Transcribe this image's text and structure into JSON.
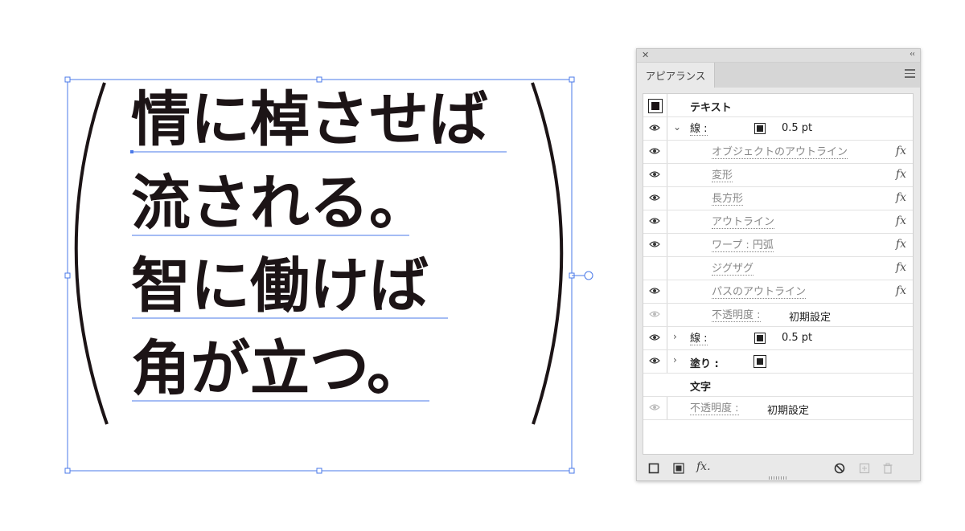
{
  "canvas": {
    "lines": [
      "情に棹させば",
      "流される。",
      "智に働けば",
      "角が立つ。"
    ],
    "text_color": "#1c1416",
    "selection_color": "#4a79e8"
  },
  "panel": {
    "tab_label": "アピアランス",
    "close_icon": "close-icon",
    "collapse_icon": "collapse-icon",
    "menu_icon": "panel-menu-icon",
    "rows": {
      "text_object": "テキスト",
      "stroke1_label": "線 :",
      "stroke1_value": "0.5 pt",
      "effects": [
        "オブジェクトのアウトライン",
        "変形",
        "長方形",
        "アウトライン",
        "ワープ : 円弧",
        "ジグザグ",
        "パスのアウトライン"
      ],
      "fx_label": "fx",
      "opacity_inner_label": "不透明度 :",
      "opacity_inner_value": "初期設定",
      "stroke2_label": "線 :",
      "stroke2_value": "0.5 pt",
      "fill_label": "塗り :",
      "char_label": "文字",
      "opacity_outer_label": "不透明度 :",
      "opacity_outer_value": "初期設定"
    },
    "bottom_bar": {
      "add_stroke": "add-stroke-icon",
      "add_fill": "add-fill-icon",
      "add_effect": "fx.",
      "clear": "clear-appearance-icon",
      "duplicate": "duplicate-item-icon",
      "delete": "trash-icon"
    }
  }
}
